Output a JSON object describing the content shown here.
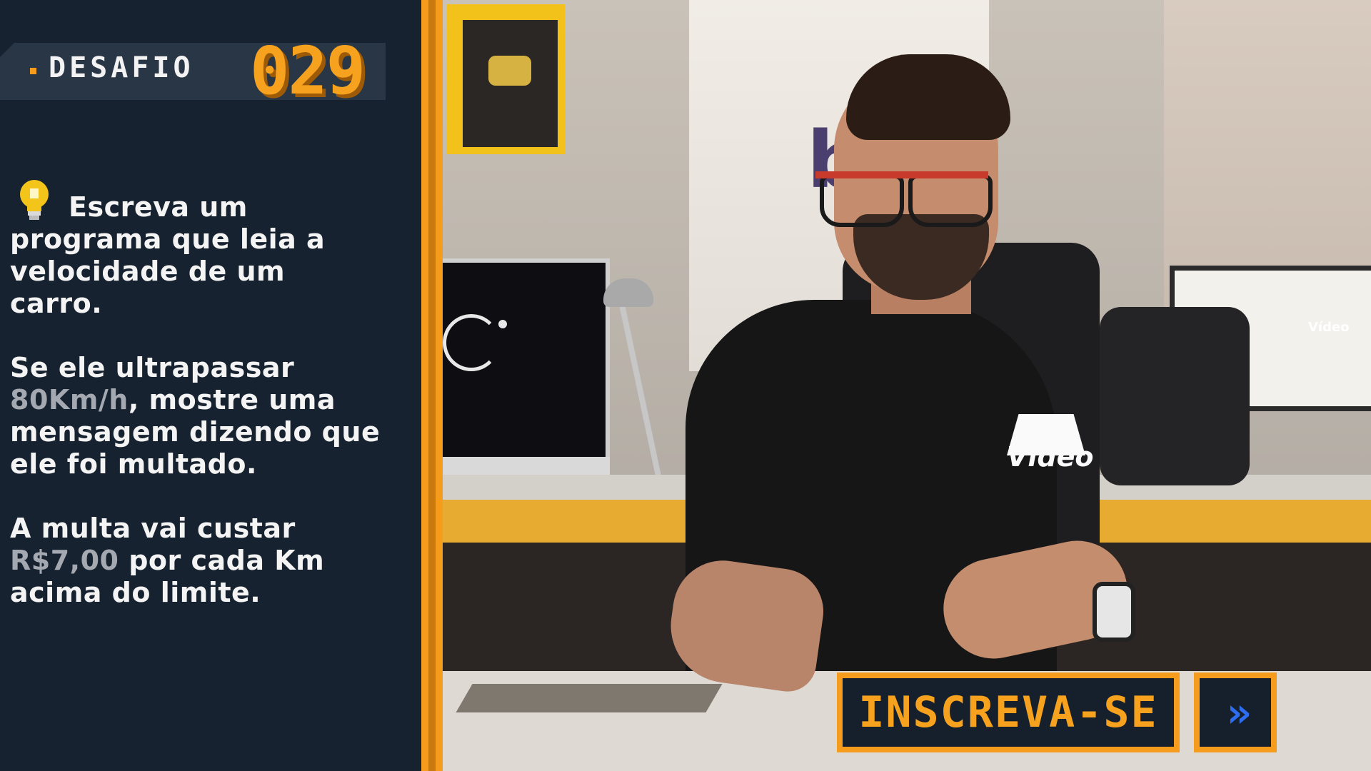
{
  "header": {
    "label": "DESAFIO",
    "number": "029"
  },
  "challenge": {
    "paragraph1": "Escreva um programa que leia a velocidade de um carro.",
    "p2_prefix": "Se ele ultrapassar",
    "p2_highlight": "80Km/h",
    "p2_suffix": ", mostre uma mensagem dizendo que ele foi multado.",
    "p3_prefix": "A multa vai custar",
    "p3_highlight": "R$7,00",
    "p3_suffix": " por cada Km acima do limite."
  },
  "scene": {
    "shirt_logo_text": "Vídeo",
    "wall_sign_text": "bt",
    "monitor_logo_text": "Vídeo"
  },
  "subscribe": {
    "label": "INSCREVA-SE",
    "arrow": "»"
  },
  "colors": {
    "accent": "#f59c1c",
    "panel_bg": "#172230",
    "highlight_text": "#a4a8b0",
    "arrow_blue": "#2e6cf0"
  },
  "icons": [
    "lightbulb-icon",
    "double-chevron-right-icon"
  ]
}
